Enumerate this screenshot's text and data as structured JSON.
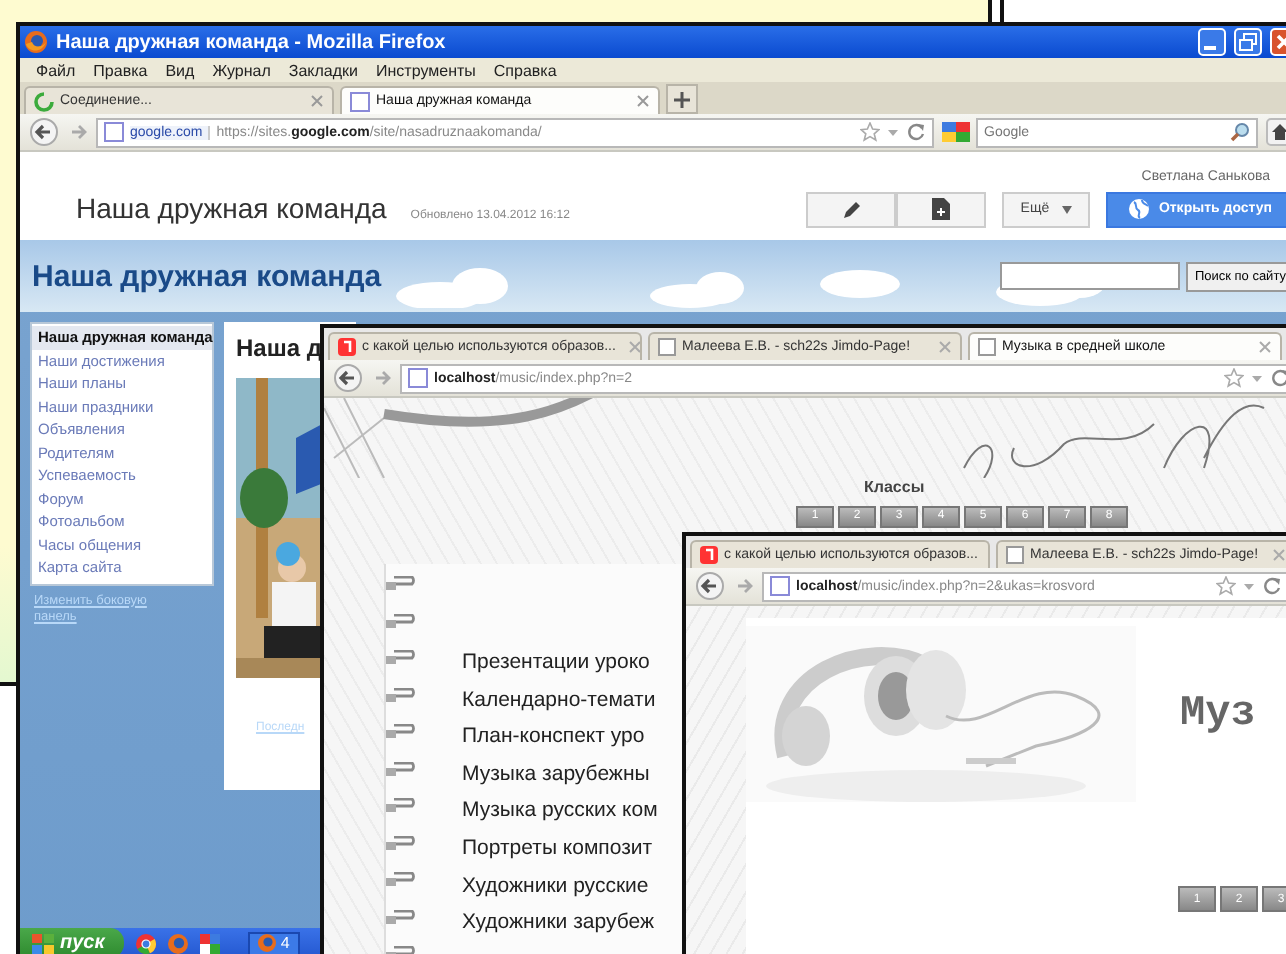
{
  "sites_window": {
    "title": "Наша дружная команда - Mozilla Firefox",
    "menu": [
      "Файл",
      "Правка",
      "Вид",
      "Журнал",
      "Закладки",
      "Инструменты",
      "Справка"
    ],
    "tabs": [
      {
        "label": "Соединение...",
        "selected": false
      },
      {
        "label": "Наша дружная команда",
        "selected": true
      }
    ],
    "address": {
      "site": "google.com",
      "url": "https://sites.**google.com**/site/nasadruznaakomanda/"
    },
    "search": {
      "placeholder": "Google"
    },
    "header": {
      "title": "Наша дружная команда",
      "updated": "Обновлено 13.04.2012 16:12",
      "user": "Светлана Санькова",
      "more": "Ещё",
      "share": "Открыть доступ"
    },
    "banner": {
      "title": "Наша дружная команда",
      "search_button": "Поиск по сайту"
    },
    "sidebar": [
      {
        "label": "Наша дружная команда",
        "selected": true
      },
      {
        "label": "Наши достижения",
        "selected": false
      },
      {
        "label": "Наши планы",
        "selected": false
      },
      {
        "label": "Наши праздники",
        "selected": false
      },
      {
        "label": "Объявления",
        "selected": false
      },
      {
        "label": "Родителям",
        "selected": false
      },
      {
        "label": "Успеваемость",
        "selected": false
      },
      {
        "label": "Форум",
        "selected": false
      },
      {
        "label": "Фотоальбом",
        "selected": false
      },
      {
        "label": "Часы общения",
        "selected": false
      },
      {
        "label": "Карта сайта",
        "selected": false
      }
    ],
    "edit_sidebar": "Изменить боковую панель",
    "content_heading": "Наша д",
    "footer_link": "Последн"
  },
  "music_window": {
    "tabs": [
      {
        "label": "с какой целью используются образов...",
        "selected": false
      },
      {
        "label": "Малеева Е.В. - sch22s Jimdo-Page!",
        "selected": false
      },
      {
        "label": "Музыка в средней школе",
        "selected": true
      }
    ],
    "address": {
      "url": "**localhost**/music/index.php?n=2"
    },
    "heading": "Классы",
    "class_buttons": [
      "1",
      "2",
      "3",
      "4",
      "5",
      "6",
      "7",
      "8"
    ],
    "menu_items": [
      "Презентации уроко",
      "Календарно-темати",
      "План-конспект уро",
      "Музыка зарубежны",
      "Музыка русских ком",
      "Портреты композит",
      "Художники русские",
      "Художники зарубеж"
    ]
  },
  "crossword_window": {
    "tabs": [
      {
        "label": "с какой целью используются образов...",
        "selected": false
      },
      {
        "label": "Малеева Е.В. - sch22s Jimdo-Page!",
        "selected": false
      }
    ],
    "address": {
      "url": "**localhost**/music/index.php?n=2&ukas=krosvord"
    },
    "heading": "Муз",
    "class_buttons": [
      "1",
      "2",
      "3"
    ]
  },
  "taskbar": {
    "start": "пуск",
    "task": "4"
  }
}
